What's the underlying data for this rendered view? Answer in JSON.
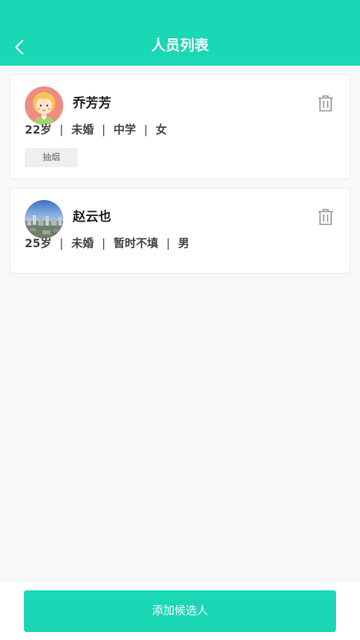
{
  "header": {
    "title": "人员列表",
    "back_icon": "chevron-left-icon",
    "background": "#1ad7b6"
  },
  "people": [
    {
      "name": "乔芳芳",
      "avatar": "cartoon-girl-avatar",
      "age": "22岁",
      "marital": "未婚",
      "education": "中学",
      "gender": "女",
      "tags": [
        "抽烟"
      ]
    },
    {
      "name": "赵云也",
      "avatar": "cityscape-photo-avatar",
      "age": "25岁",
      "marital": "未婚",
      "education": "暂时不填",
      "gender": "男",
      "tags": []
    }
  ],
  "separator": "|",
  "footer": {
    "add_label": "添加候选人",
    "accent": "#1ad7b6"
  }
}
